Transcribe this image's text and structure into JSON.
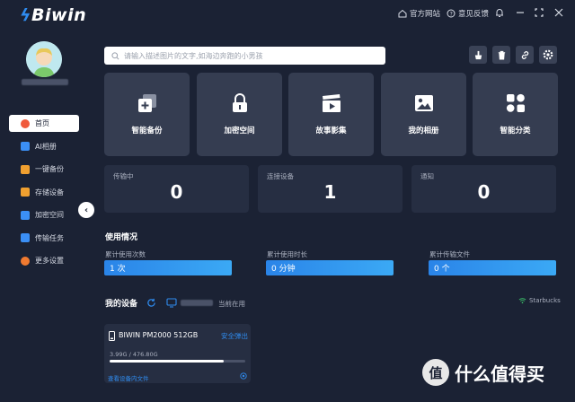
{
  "app": {
    "logo": "Biwin",
    "top_links": {
      "website": "官方网站",
      "feedback": "意见反馈"
    }
  },
  "sidebar": {
    "collapse_glyph": "‹",
    "items": [
      {
        "label": "首页",
        "icon": "home-icon",
        "color": "#f05a3c",
        "active": true
      },
      {
        "label": "AI相册",
        "icon": "ai-album-icon",
        "color": "#3b8ff5"
      },
      {
        "label": "一键备份",
        "icon": "backup-icon",
        "color": "#f0a030"
      },
      {
        "label": "存储设备",
        "icon": "storage-icon",
        "color": "#f0a030"
      },
      {
        "label": "加密空间",
        "icon": "lock-folder-icon",
        "color": "#3b8ff5"
      },
      {
        "label": "传输任务",
        "icon": "transfer-icon",
        "color": "#3b8ff5"
      },
      {
        "label": "更多设置",
        "icon": "settings-icon",
        "color": "#f07a30"
      }
    ]
  },
  "search": {
    "placeholder": "请输入描述图片的文字,如海边奔跑的小男孩"
  },
  "tiles": [
    {
      "label": "智能备份",
      "icon": "smart-backup-icon"
    },
    {
      "label": "加密空间",
      "icon": "lock-icon"
    },
    {
      "label": "故事影集",
      "icon": "clapperboard-icon"
    },
    {
      "label": "我的相册",
      "icon": "photo-icon"
    },
    {
      "label": "智能分类",
      "icon": "category-icon"
    }
  ],
  "stats": [
    {
      "label": "传输中",
      "value": "0"
    },
    {
      "label": "连接设备",
      "value": "1"
    },
    {
      "label": "通知",
      "value": "0"
    }
  ],
  "usage": {
    "title": "使用情况",
    "items": [
      {
        "label": "累计使用次数",
        "value": "1 次"
      },
      {
        "label": "累计使用时长",
        "value": "0 分钟"
      },
      {
        "label": "累计传输文件",
        "value": "0 个"
      }
    ]
  },
  "devices": {
    "title": "我的设备",
    "current_status": "当前在用",
    "wifi_name": "Starbucks",
    "card": {
      "name": "BIWIN PM2000 512GB",
      "eject": "安全弹出",
      "capacity": "3.99G / 476.80G",
      "used_fraction": 0.84,
      "view_files": "查看设备内文件"
    }
  },
  "watermark": {
    "badge": "值",
    "text": "什么值得买"
  },
  "colors": {
    "accent": "#2f8cf0",
    "background": "#1b2234",
    "tile": "#353d51"
  }
}
